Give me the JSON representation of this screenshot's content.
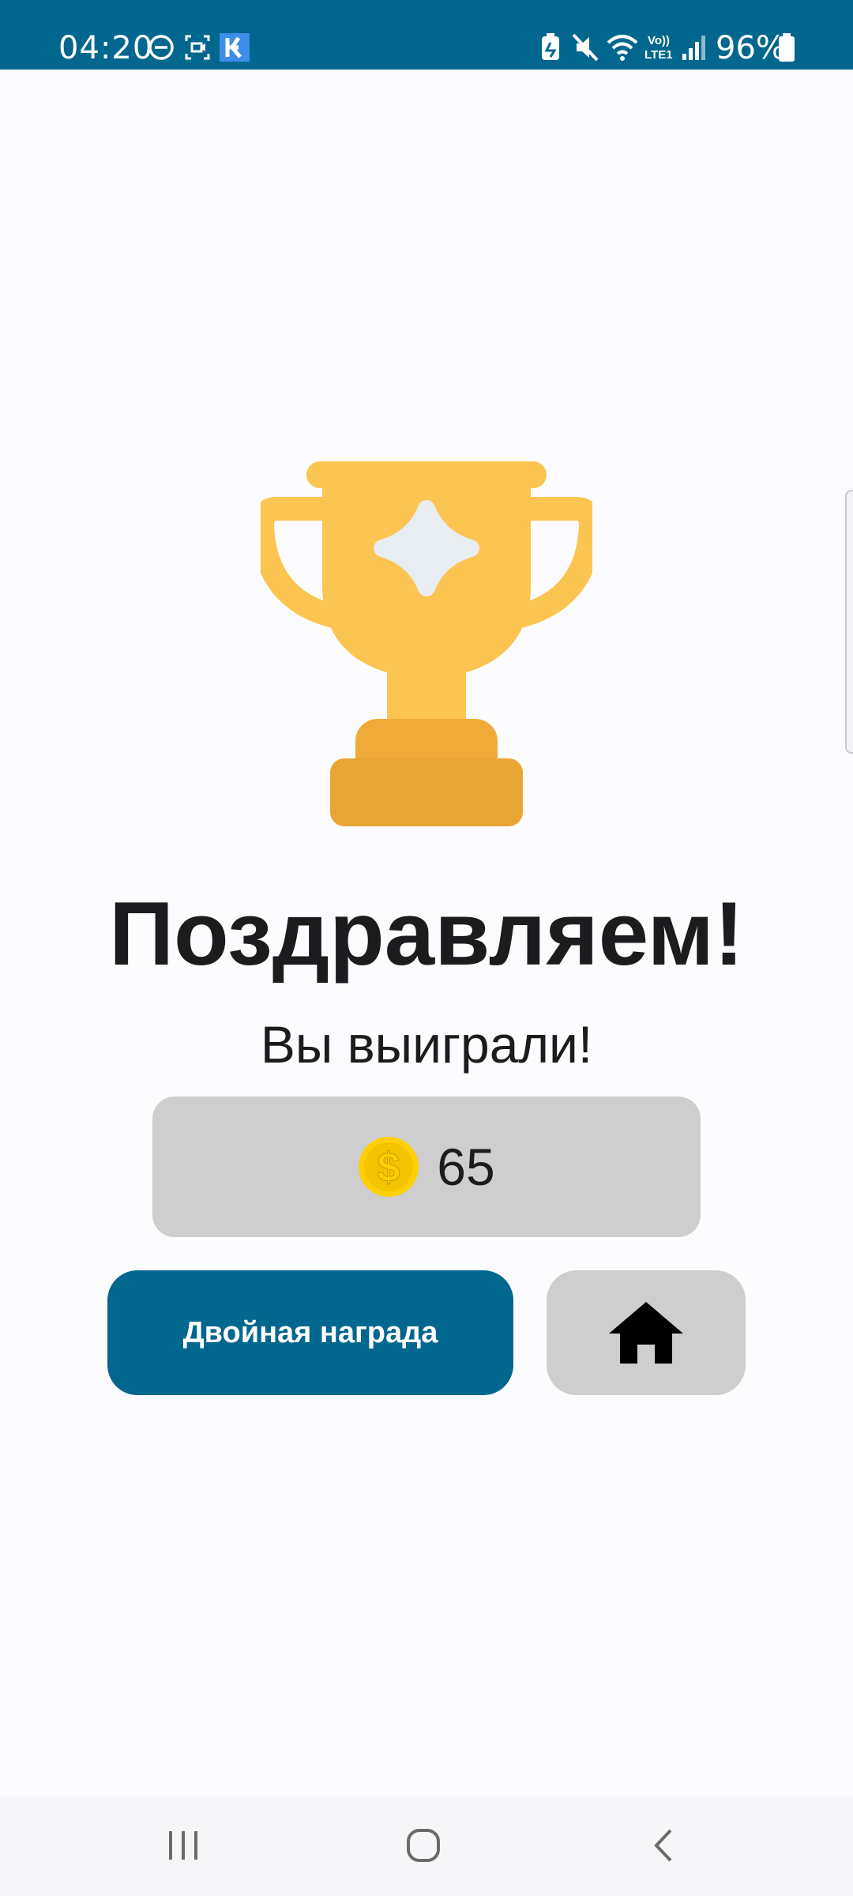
{
  "status_bar": {
    "time": "04:20",
    "battery_percent": "96%",
    "network_label": "Vo)) LTE1",
    "background_color": "#01678e"
  },
  "main": {
    "title": "Поздравляем!",
    "subtitle": "Вы выиграли!",
    "reward_icon": "coin-icon",
    "reward_amount": "65",
    "double_reward_label": "Двойная награда",
    "home_icon": "home-icon"
  },
  "nav": {
    "recent_icon": "recent-apps-icon",
    "home_icon": "home-circle-icon",
    "back_icon": "back-icon"
  },
  "colors": {
    "accent": "#01678e",
    "trophy_gold": "#fcc450",
    "trophy_base": "#e8a634",
    "coin": "#ffd000",
    "card_gray": "#cecece"
  }
}
